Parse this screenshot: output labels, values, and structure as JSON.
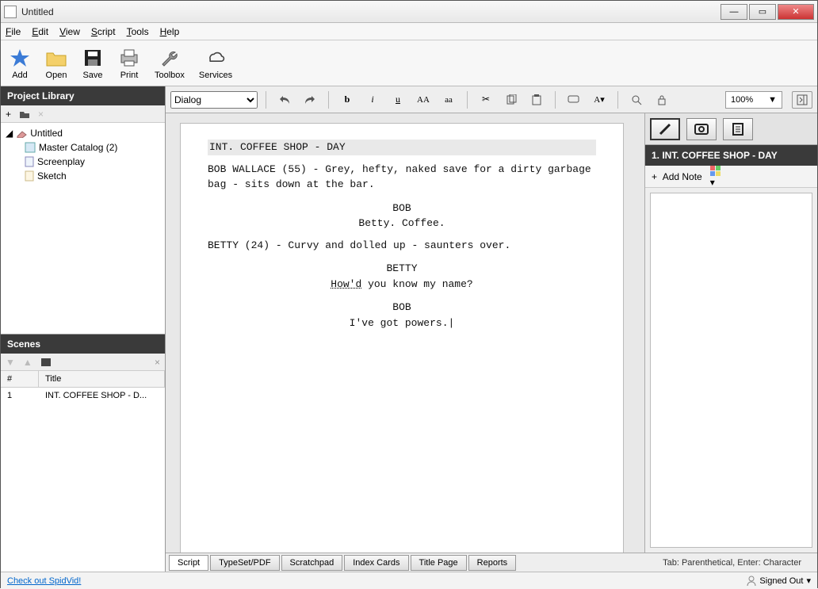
{
  "window": {
    "title": "Untitled"
  },
  "menu": [
    "File",
    "Edit",
    "View",
    "Script",
    "Tools",
    "Help"
  ],
  "toolbar": [
    {
      "id": "add",
      "label": "Add"
    },
    {
      "id": "open",
      "label": "Open"
    },
    {
      "id": "save",
      "label": "Save"
    },
    {
      "id": "print",
      "label": "Print"
    },
    {
      "id": "toolbox",
      "label": "Toolbox"
    },
    {
      "id": "services",
      "label": "Services"
    }
  ],
  "formatbar": {
    "element_type": "Dialog",
    "zoom": "100%"
  },
  "left": {
    "library_title": "Project Library",
    "tree_root": "Untitled",
    "tree_items": [
      "Master Catalog (2)",
      "Screenplay",
      "Sketch"
    ],
    "scenes_title": "Scenes",
    "scene_cols": {
      "num": "#",
      "title": "Title"
    },
    "scene_rows": [
      {
        "num": "1",
        "title": "INT. COFFEE SHOP - D..."
      }
    ]
  },
  "script": {
    "slug": "INT. COFFEE SHOP - DAY",
    "action1": "BOB WALLACE (55) - Grey, hefty, naked save for a dirty garbage bag - sits down at the bar.",
    "char1": "BOB",
    "dialog1": "Betty.  Coffee.",
    "action2": "BETTY (24) - Curvy and dolled up - saunters over.",
    "char2": "BETTY",
    "dialog2_pre": "How'd",
    "dialog2_post": " you know my name?",
    "char3": "BOB",
    "dialog3": "I've got powers."
  },
  "right": {
    "scene_label": "1. INT. COFFEE SHOP - DAY",
    "add_note": "Add Note"
  },
  "bottom_tabs": [
    "Script",
    "TypeSet/PDF",
    "Scratchpad",
    "Index Cards",
    "Title Page",
    "Reports"
  ],
  "bottom_hint": "Tab: Parenthetical, Enter: Character",
  "status": {
    "link": "Check out SpidVid!",
    "signed": "Signed Out"
  }
}
